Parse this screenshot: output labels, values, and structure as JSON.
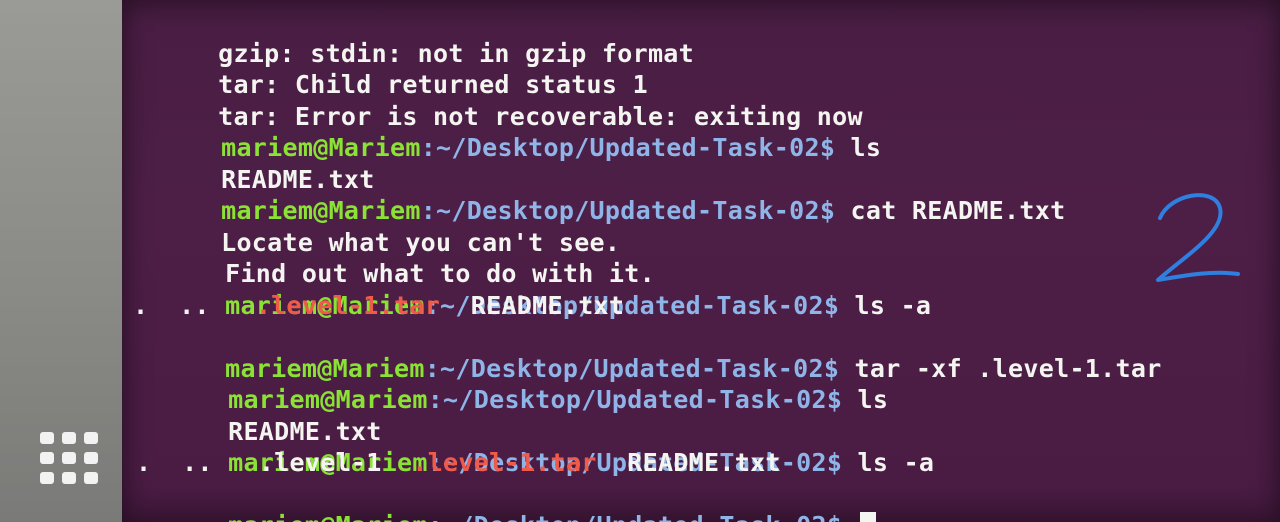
{
  "desktop": {
    "apps_icon": "show-applications-icon"
  },
  "terminal": {
    "prompt": {
      "user_host": "mariem@Mariem",
      "path": ":~/Desktop/Updated-Task-02$"
    },
    "lines": [
      {
        "kind": "output",
        "text": "gzip: stdin: not in gzip format"
      },
      {
        "kind": "output",
        "text": "tar: Child returned status 1"
      },
      {
        "kind": "output",
        "text": "tar: Error is not recoverable: exiting now"
      },
      {
        "kind": "command",
        "cmd": " ls"
      },
      {
        "kind": "output",
        "text": "README.txt"
      },
      {
        "kind": "command",
        "cmd": " cat README.txt"
      },
      {
        "kind": "output",
        "text": "Locate what you can't see."
      },
      {
        "kind": "output",
        "text": "Find out what to do with it."
      },
      {
        "kind": "command",
        "cmd": " ls -a"
      },
      {
        "kind": "listing",
        "items": [
          ".",
          "..",
          ".level-1.tar",
          "README.txt"
        ]
      },
      {
        "kind": "command",
        "cmd": " tar -xf .level-1.tar"
      },
      {
        "kind": "command",
        "cmd": " ls"
      },
      {
        "kind": "output",
        "text": "README.txt"
      },
      {
        "kind": "command",
        "cmd": " ls -a"
      },
      {
        "kind": "listing",
        "items": [
          ".",
          "..",
          ".level-1",
          ".level-1.tar",
          "README.txt"
        ]
      },
      {
        "kind": "command",
        "cmd": " "
      }
    ]
  },
  "annotation": {
    "colors": {
      "ink": "#2f7fe0"
    }
  },
  "colors": {
    "terminal_bg": "#4a1e44",
    "prompt_user": "#8ae234",
    "prompt_path": "#8fb4e8",
    "archive_file": "#ef5a4a",
    "text": "#f4f4f0"
  }
}
